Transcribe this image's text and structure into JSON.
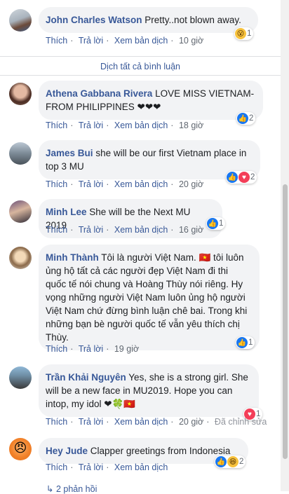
{
  "translate_all": "Dịch tất cả bình luận",
  "actions": {
    "like": "Thích",
    "reply": "Trả lời",
    "translate": "Xem bản dịch",
    "edited": "Đã chỉnh sửa"
  },
  "comments": [
    {
      "name": "John Charles Watson",
      "text": "Pretty..not blown away.",
      "time": "10 giờ",
      "reaction_count": "1"
    },
    {
      "name": "Athena Gabbana Rivera",
      "text": "LOVE MISS VIETNAM-FROM PHILIPPINES ❤❤❤",
      "time": "18 giờ",
      "reaction_count": "2"
    },
    {
      "name": "James Bui",
      "text": "she will be our first Vietnam place in top 3 MU",
      "time": "20 giờ",
      "reaction_count": "2"
    },
    {
      "name": "Minh Lee",
      "text": "She will be the Next MU 2019",
      "time": "16 giờ",
      "reaction_count": "1"
    },
    {
      "name": "Minh Thành",
      "text": "Tôi là người Việt Nam. 🇻🇳 tôi luôn ủng hộ tất cả các người đẹp Việt Nam đi thi quốc tế nói chung và Hoàng Thùy nói riêng. Hy vọng những người Việt Nam luôn ủng hộ người Việt Nam chứ đừng bình luận chê bai. Trong khi những bạn bè người quốc tế vẫn yêu thích chị Thùy.",
      "time": "19 giờ",
      "reaction_count": "1"
    },
    {
      "name": "Trần Khải Nguyên",
      "text": "Yes, she is a strong girl. She will be a new face in MU2019. Hope you can intop, my idol ❤🍀🇻🇳",
      "time": "20 giờ",
      "reaction_count": "1"
    },
    {
      "name": "Hey Jude",
      "text": "Clapper greetings from Indonesia",
      "reaction_count": "2"
    }
  ],
  "replies_label": "2 phản hồi",
  "icons": {
    "like": "like-icon",
    "love": "love-icon",
    "wow": "wow-icon",
    "haha": "haha-icon",
    "reply_arrow": "reply-arrow-icon"
  },
  "colors": {
    "name": "#385898",
    "bubble": "#f2f3f5",
    "like": "#1877f2",
    "love": "#f33e58"
  }
}
